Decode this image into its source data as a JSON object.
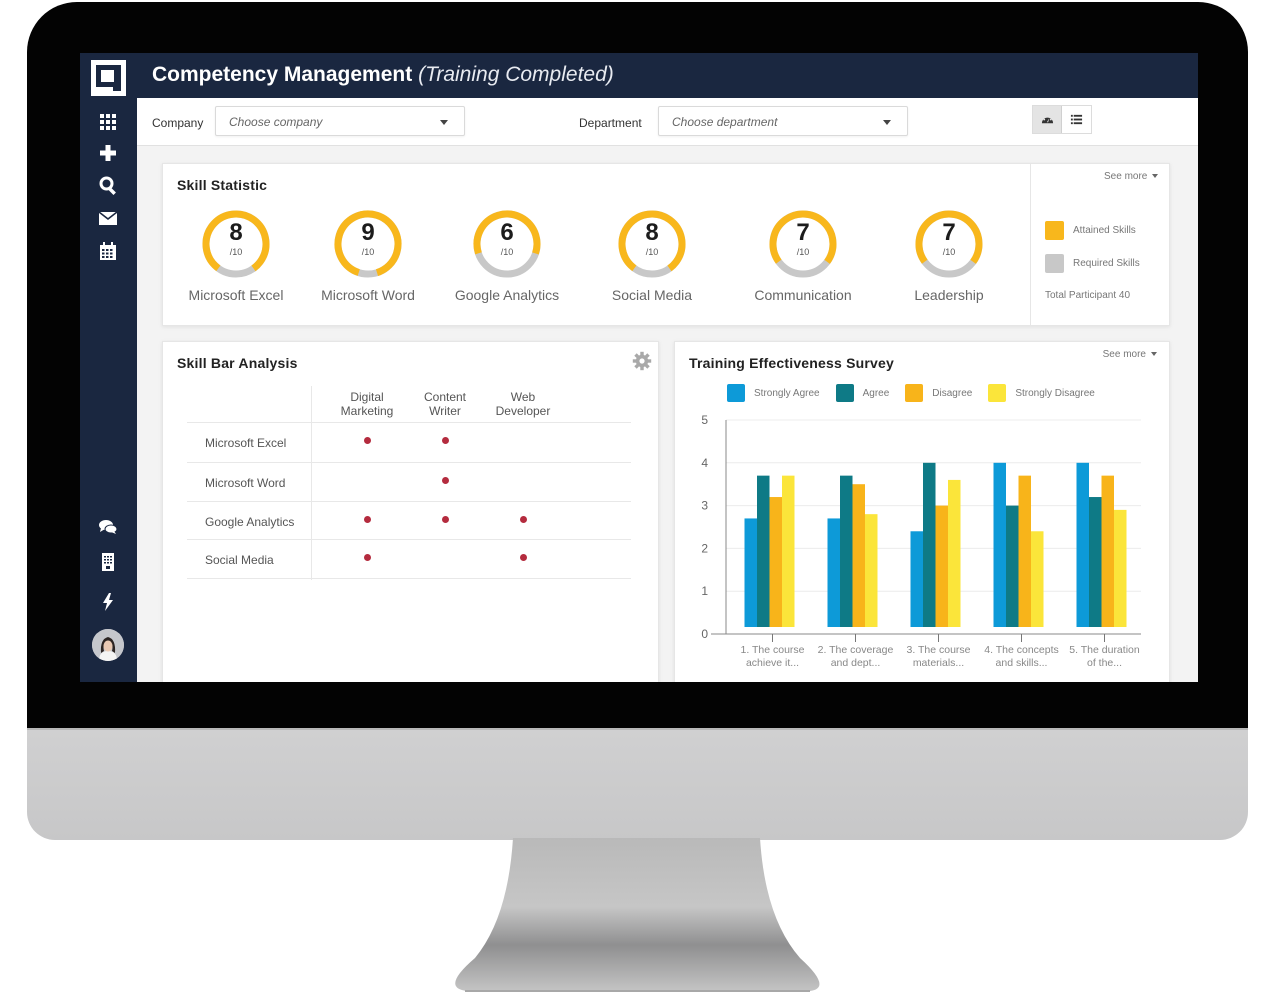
{
  "app": {
    "title": "Competency Management",
    "subtitle": "(Training Completed)"
  },
  "sidebar": {
    "top_icons": [
      "apps-grid-icon",
      "plus-icon",
      "search-icon",
      "mail-icon",
      "calendar-icon"
    ],
    "bottom_icons": [
      "chat-icon",
      "document-icon",
      "lightning-icon"
    ],
    "avatar": "user-avatar"
  },
  "filters": {
    "company_label": "Company",
    "company_placeholder": "Choose company",
    "department_label": "Department",
    "department_placeholder": "Choose department",
    "view_toggle": [
      {
        "icon": "dashboard-icon",
        "active": true
      },
      {
        "icon": "list-icon",
        "active": false
      }
    ]
  },
  "skill_statistic": {
    "title": "Skill Statistic",
    "see_more": "See more",
    "skills": [
      {
        "name": "Microsoft Excel",
        "score": "8",
        "max": "/10",
        "value": 8,
        "out_of": 10
      },
      {
        "name": "Microsoft Word",
        "score": "9",
        "max": "/10",
        "value": 9,
        "out_of": 10
      },
      {
        "name": "Google Analytics",
        "score": "6",
        "max": "/10",
        "value": 6,
        "out_of": 10
      },
      {
        "name": "Social Media",
        "score": "8",
        "max": "/10",
        "value": 8,
        "out_of": 10
      },
      {
        "name": "Communication",
        "score": "7",
        "max": "/10",
        "value": 7,
        "out_of": 10
      },
      {
        "name": "Leadership",
        "score": "7",
        "max": "/10",
        "value": 7,
        "out_of": 10
      }
    ],
    "legend": [
      {
        "label": "Attained Skills",
        "color": "#f8b71c"
      },
      {
        "label": "Required Skills",
        "color": "#c8c8c8"
      }
    ],
    "total_participant": "Total Participant 40"
  },
  "skill_bar_analysis": {
    "title": "Skill Bar Analysis",
    "columns": [
      {
        "line1": "Digital",
        "line2": "Marketing"
      },
      {
        "line1": "Content",
        "line2": "Writer"
      },
      {
        "line1": "Web",
        "line2": "Developer"
      }
    ],
    "rows": [
      {
        "label": "Microsoft Excel",
        "marks": [
          true,
          true,
          false
        ]
      },
      {
        "label": "Microsoft Word",
        "marks": [
          false,
          true,
          false
        ]
      },
      {
        "label": "Google Analytics",
        "marks": [
          true,
          true,
          true
        ]
      },
      {
        "label": "Social Media",
        "marks": [
          true,
          false,
          true
        ]
      }
    ],
    "dot_color": "#b42b3e"
  },
  "training_survey": {
    "title": "Training Effectiveness Survey",
    "see_more": "See more"
  },
  "chart_data": {
    "type": "bar",
    "title": "Training Effectiveness Survey",
    "xlabel": "",
    "ylabel": "",
    "ylim": [
      0,
      5
    ],
    "yticks": [
      0,
      1,
      2,
      3,
      4,
      5
    ],
    "grid": true,
    "legend_position": "top",
    "categories": [
      [
        "1. The course",
        "achieve it..."
      ],
      [
        "2. The coverage",
        "and dept..."
      ],
      [
        "3. The course",
        "materials..."
      ],
      [
        "4. The concepts",
        "and skills..."
      ],
      [
        "5. The duration",
        "of the..."
      ]
    ],
    "series": [
      {
        "name": "Strongly Agree",
        "color": "#0d9ad8",
        "values": [
          2.7,
          2.7,
          2.4,
          4.0,
          4.0
        ]
      },
      {
        "name": "Agree",
        "color": "#0e7a86",
        "values": [
          3.7,
          3.7,
          4.0,
          3.0,
          3.2
        ]
      },
      {
        "name": "Disagree",
        "color": "#f8b41a",
        "values": [
          3.2,
          3.5,
          3.0,
          3.7,
          3.7
        ]
      },
      {
        "name": "Strongly Disagree",
        "color": "#fbe53a",
        "values": [
          3.7,
          2.8,
          3.6,
          2.4,
          2.9
        ]
      }
    ]
  }
}
